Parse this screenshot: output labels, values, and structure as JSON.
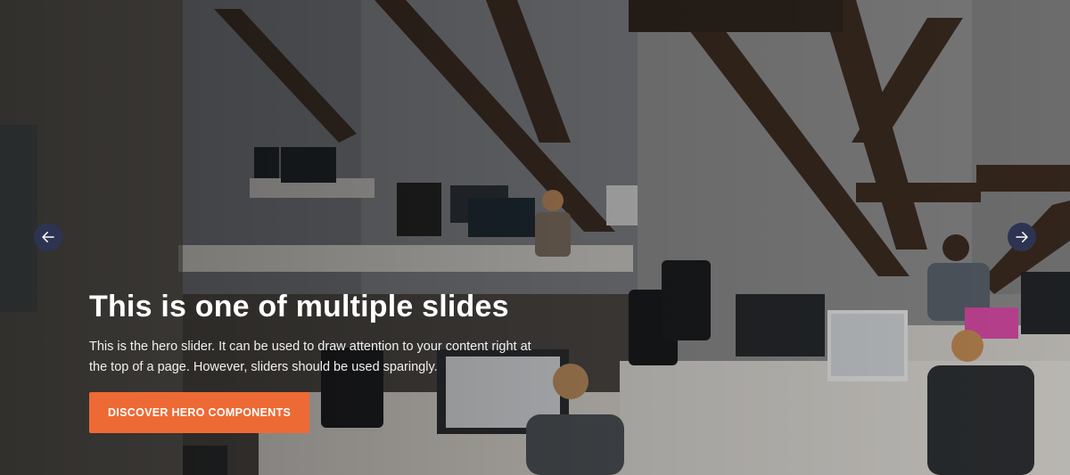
{
  "hero": {
    "slide_title": "This is one of multiple slides",
    "slide_text": "This is the hero slider. It can be used to draw attention to your content right at the top of a page. However, sliders should be used sparingly.",
    "cta_label": "DISCOVER HERO COMPONENTS",
    "prev_icon": "arrow-left-icon",
    "next_icon": "arrow-right-icon",
    "colors": {
      "cta_background": "#ee6a35",
      "nav_background": "#2c3452",
      "text": "#ffffff"
    }
  }
}
